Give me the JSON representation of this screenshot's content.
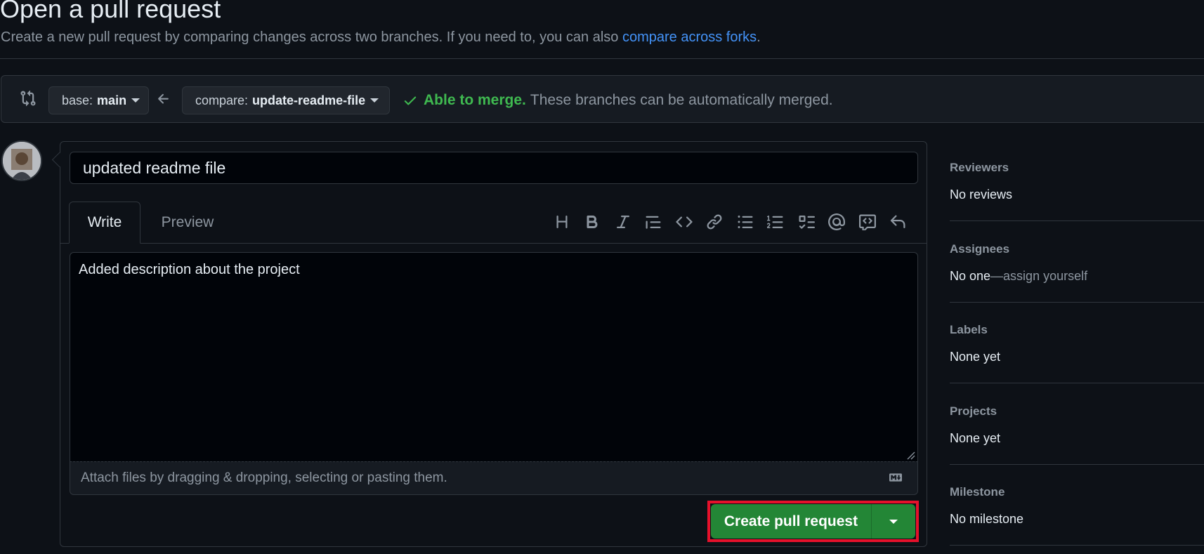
{
  "header": {
    "title": "Open a pull request",
    "subtitle_prefix": "Create a new pull request by comparing changes across two branches. If you need to, you can also ",
    "subtitle_link": "compare across forks",
    "subtitle_suffix": "."
  },
  "compare": {
    "base_label": "base:",
    "base_value": "main",
    "compare_label": "compare:",
    "compare_value": "update-readme-file",
    "merge_ok": "Able to merge.",
    "merge_msg": "These branches can be automatically merged."
  },
  "form": {
    "title_value": "updated readme file",
    "tabs": {
      "write": "Write",
      "preview": "Preview"
    },
    "toolbar_icons": [
      "heading-icon",
      "bold-icon",
      "italic-icon",
      "quote-icon",
      "code-icon",
      "link-icon",
      "unordered-list-icon",
      "ordered-list-icon",
      "task-list-icon",
      "mention-icon",
      "reference-icon",
      "undo-icon"
    ],
    "body_value": "Added description about the project",
    "attach_text": "Attach files by dragging & dropping, selecting or pasting them.",
    "submit_label": "Create pull request"
  },
  "sidebar": {
    "reviewers": {
      "heading": "Reviewers",
      "value": "No reviews"
    },
    "assignees": {
      "heading": "Assignees",
      "value": "No one",
      "link": "—assign yourself"
    },
    "labels": {
      "heading": "Labels",
      "value": "None yet"
    },
    "projects": {
      "heading": "Projects",
      "value": "None yet"
    },
    "milestone": {
      "heading": "Milestone",
      "value": "No milestone"
    }
  },
  "colors": {
    "background": "#0d1117",
    "accent_link": "#4493f8",
    "success": "#3fb950",
    "primary_button": "#238636",
    "highlight": "#e5112b"
  }
}
